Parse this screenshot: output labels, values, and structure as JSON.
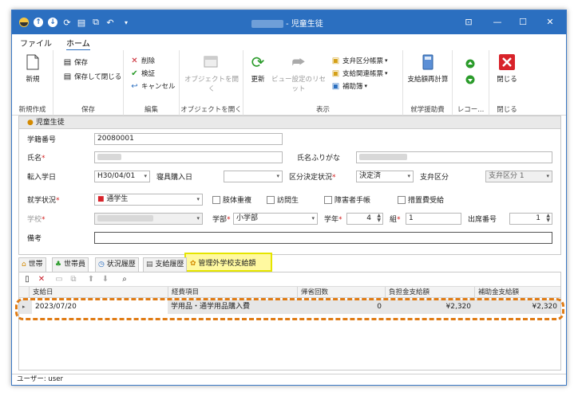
{
  "window": {
    "title": "- 児童生徒",
    "controls": {
      "minimize": "—",
      "maximize": "☐",
      "close": "✕",
      "extra": "⊡"
    }
  },
  "quick_access": {
    "icons": [
      "app-icon",
      "up-icon",
      "down-icon",
      "refresh-icon",
      "save-icon",
      "new-icon",
      "undo-icon",
      "dropdown-icon"
    ]
  },
  "menu": {
    "file": "ファイル",
    "home": "ホーム"
  },
  "ribbon": {
    "new_group": {
      "new_label": "新規",
      "group_label": "新規作成"
    },
    "save_group": {
      "save_label": "保存",
      "save_close_label": "保存して閉じる",
      "group_label": "保存"
    },
    "edit_group": {
      "delete_label": "削除",
      "validate_label": "検証",
      "cancel_label": "キャンセル",
      "group_label": "編集"
    },
    "open_group": {
      "open_label": "オブジェクトを開く",
      "group_label": "オブジェクトを開く"
    },
    "view_group": {
      "refresh_label": "更新",
      "reset_view_label": "ビュー設定のリセット",
      "ledger1_label": "支弁区分帳票",
      "ledger2_label": "支給関連帳票",
      "subsidy_label": "補助簿",
      "group_label": "表示"
    },
    "calc_group": {
      "recalc_label": "支給額再計算",
      "group_label": "就学援助費"
    },
    "record_group": {
      "group_label": "レコー..."
    },
    "close_group": {
      "close_label": "閉じる",
      "group_label": "閉じる"
    }
  },
  "panel": {
    "title": "児童生徒",
    "fields": {
      "student_no_label": "学籍番号",
      "student_no_value": "20080001",
      "name_label": "氏名",
      "name_kana_label": "氏名ふりがな",
      "transfer_date_label": "転入学日",
      "transfer_date_value": "H30/04/01",
      "bedding_date_label": "寝具購入日",
      "category_status_label": "区分決定状況",
      "category_status_value": "決定済",
      "payer_category_label": "支弁区分",
      "payer_category_value": "支弁区分 1",
      "attendance_label": "就学状況",
      "attendance_value": "通学生",
      "disability_dup_label": "肢体重複",
      "visiting_label": "訪問生",
      "handbook_label": "障害者手帳",
      "measure_label": "措置費受給",
      "school_label": "学校",
      "dept_label": "学部",
      "dept_value": "小学部",
      "grade_label": "学年",
      "grade_value": "4",
      "class_label": "組",
      "class_value": "1",
      "attend_no_label": "出席番号",
      "attend_no_value": "1",
      "remarks_label": "備考"
    }
  },
  "tabs": [
    "世帯",
    "世帯員",
    "状況履歴",
    "支給履歴",
    "管理外学校支給額"
  ],
  "grid": {
    "columns": [
      "支給日",
      "経費項目",
      "帰省回数",
      "負担金支給額",
      "補助金支給額"
    ],
    "rows": [
      {
        "date": "2023/07/20",
        "item": "学用品・通学用品購入費",
        "count": "0",
        "burden": "¥2,320",
        "subsidy": "¥2,320"
      }
    ]
  },
  "status": {
    "user": "ユーザー: user"
  },
  "colors": {
    "titlebar": "#2b6fc0",
    "highlight": "#fff9a0",
    "dash": "#e07b14",
    "required": "#d32020"
  }
}
